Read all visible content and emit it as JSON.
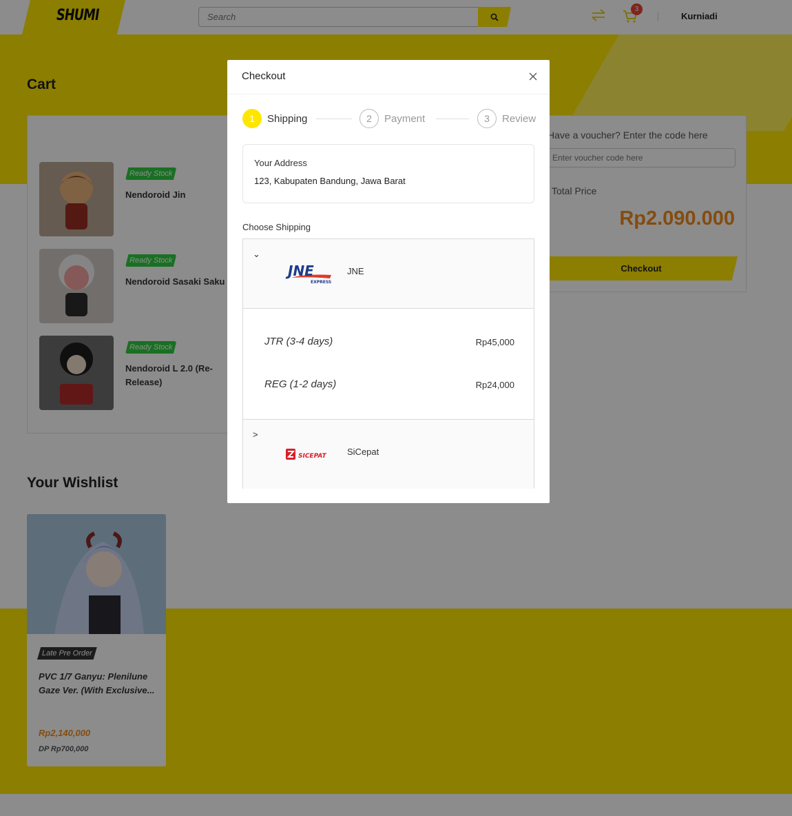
{
  "header": {
    "logo": "SHUMI",
    "search_placeholder": "Search",
    "cart_count": "3",
    "user": "Kurniadi"
  },
  "cart": {
    "title": "Cart",
    "items": [
      {
        "badge": "Ready Stock",
        "name": "Nendoroid Jin"
      },
      {
        "badge": "Ready Stock",
        "name": "Nendoroid Sasaki Saku"
      },
      {
        "badge": "Ready Stock",
        "name": "Nendoroid L 2.0 (Re-Release)"
      }
    ]
  },
  "summary": {
    "voucher_label": "Have a voucher? Enter the code here",
    "voucher_placeholder": "Enter voucher code here",
    "price_label": "Total Price",
    "total": "Rp2.090.000",
    "checkout_label": "Checkout"
  },
  "wishlist": {
    "title": "Your Wishlist",
    "item": {
      "badge": "Late Pre Order",
      "name": "PVC 1/7 Ganyu: Plenilune Gaze Ver. (With Exclusive...",
      "price": "Rp2,140,000",
      "dp": "DP Rp700,000"
    }
  },
  "modal": {
    "title": "Checkout",
    "steps": [
      {
        "num": "1",
        "label": "Shipping",
        "active": true
      },
      {
        "num": "2",
        "label": "Payment",
        "active": false
      },
      {
        "num": "3",
        "label": "Review",
        "active": false
      }
    ],
    "address_label": "Your Address",
    "address_value": "123, Kabupaten Bandung, Jawa Barat",
    "choose_shipping": "Choose Shipping",
    "carriers": [
      {
        "name": "JNE",
        "logo_text": "JNE",
        "logo_sub": "EXPRESS",
        "expanded": true,
        "chevron": "⌄",
        "options": [
          {
            "name": "JTR (3-4 days)",
            "price": "Rp45,000"
          },
          {
            "name": "REG (1-2 days)",
            "price": "Rp24,000"
          }
        ]
      },
      {
        "name": "SiCepat",
        "logo_text": "SICEPAT",
        "expanded": false,
        "chevron": ">"
      }
    ]
  },
  "colors": {
    "brand_yellow": "#ffe600",
    "price_orange": "#f08a1c",
    "stock_green": "#2ecc40",
    "badge_red": "#e8423a"
  }
}
